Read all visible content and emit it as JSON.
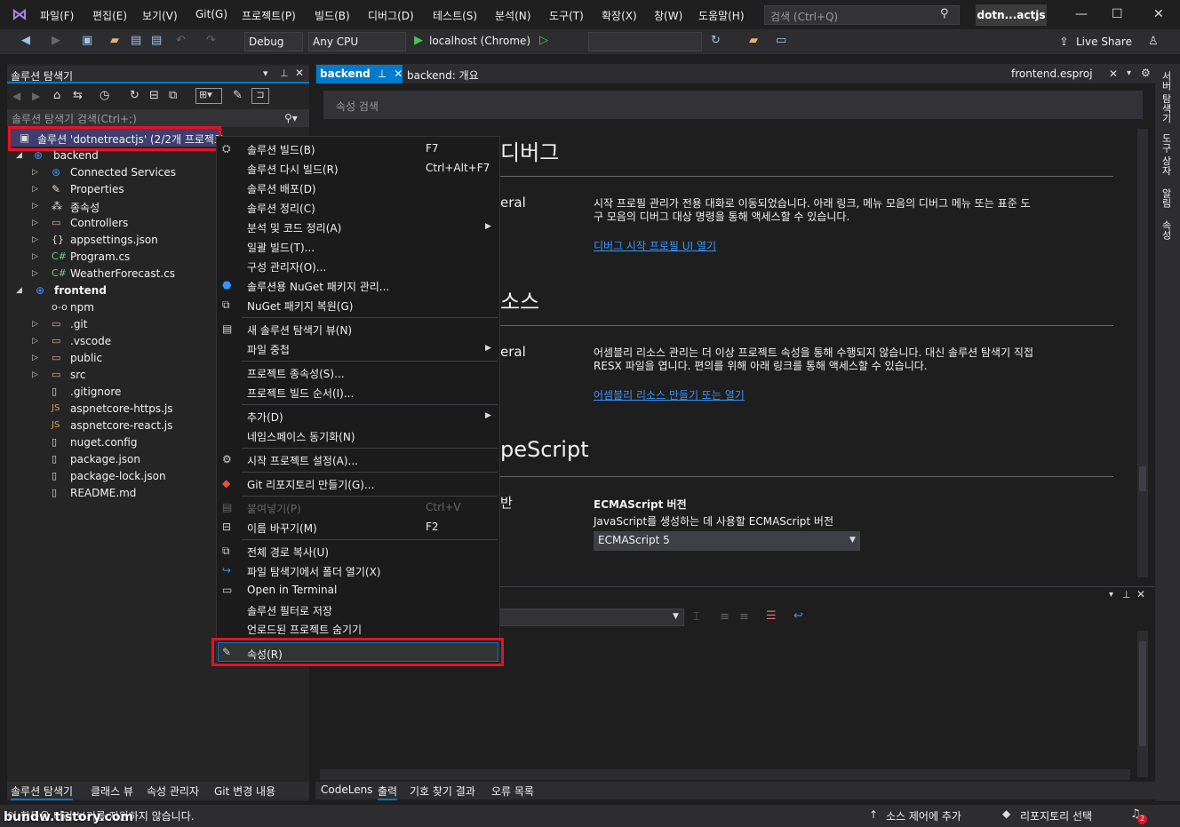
{
  "menubar": {
    "items": [
      "파일(F)",
      "편집(E)",
      "보기(V)",
      "Git(G)",
      "프로젝트(P)",
      "빌드(B)",
      "디버그(D)",
      "테스트(S)",
      "분석(N)",
      "도구(T)",
      "확장(X)",
      "창(W)",
      "도움말(H)"
    ],
    "search_placeholder": "검색 (Ctrl+Q)",
    "solution_name": "dotn...actjs"
  },
  "toolbar": {
    "config": "Debug",
    "platform": "Any CPU",
    "run_target": "localhost (Chrome)",
    "live_share": "Live Share"
  },
  "solution_explorer": {
    "title": "솔루션 탐색기",
    "search_placeholder": "솔루션 탐색기 검색(Ctrl+;)",
    "solution_label": "솔루션 'dotnetreactjs' (2/2개 프로젝트",
    "items": [
      {
        "label": "backend",
        "bold": false
      },
      {
        "label": "Connected Services"
      },
      {
        "label": "Properties"
      },
      {
        "label": "종속성"
      },
      {
        "label": "Controllers"
      },
      {
        "label": "appsettings.json"
      },
      {
        "label": "Program.cs"
      },
      {
        "label": "WeatherForecast.cs"
      },
      {
        "label": "frontend"
      },
      {
        "label": "npm"
      },
      {
        "label": ".git"
      },
      {
        "label": ".vscode"
      },
      {
        "label": "public"
      },
      {
        "label": "src"
      },
      {
        "label": ".gitignore"
      },
      {
        "label": "aspnetcore-https.js"
      },
      {
        "label": "aspnetcore-react.js"
      },
      {
        "label": "nuget.config"
      },
      {
        "label": "package.json"
      },
      {
        "label": "package-lock.json"
      },
      {
        "label": "README.md"
      }
    ],
    "bottom_tabs": [
      "솔루션 탐색기",
      "클래스 뷰",
      "속성 관리자",
      "Git 변경 내용"
    ]
  },
  "doc_tabs": {
    "tab1": "backend",
    "tab2": "backend: 개요",
    "tab3": "frontend.esproj"
  },
  "properties": {
    "search_placeholder": "속성 검색",
    "section1_title": "디버그",
    "section1_sub": "eral",
    "section1_desc": "시작 프로필 관리가 전용 대화로 이동되었습니다. 아래 링크, 메뉴 모음의 디버그 메뉴 또는 표준 도구 모음의 디버그 대상 명령을 통해 액세스할 수 있습니다.",
    "section1_link": "디버그 시작 프로필 UI 열기",
    "section2_title": "소스",
    "section2_sub": "eral",
    "section2_desc": "어셈블리 리소스 관리는 더 이상 프로젝트 속성을 통해 수행되지 않습니다. 대신 솔루션 탐색기 직접 RESX 파일을 엽니다. 편의를 위해 아래 링크를 통해 액세스할 수 있습니다.",
    "section2_link": "어셈블리 리소스 만들기 또는 열기",
    "section3_title": "peScript",
    "section3_sub": "반",
    "ecma_label": "ECMAScript 버전",
    "ecma_desc": "JavaScript를 생성하는 데 사용할 ECMAScript 버전",
    "ecma_value": "ECMAScript 5"
  },
  "output_tabs": [
    "CodeLens",
    "출력",
    "기호 찾기 결과",
    "오류 목록"
  ],
  "right_strip": [
    "서버 탐색기",
    "도구 상자",
    "알림",
    "속성"
  ],
  "context_menu": [
    {
      "label": "솔루션 빌드(B)",
      "key": "F7"
    },
    {
      "label": "솔루션 다시 빌드(R)",
      "key": "Ctrl+Alt+F7"
    },
    {
      "label": "솔루션 배포(D)",
      "key": ""
    },
    {
      "label": "솔루션 정리(C)",
      "key": ""
    },
    {
      "label": "분석 및 코드 정리(A)",
      "key": ""
    },
    {
      "label": "일괄 빌드(T)...",
      "key": ""
    },
    {
      "label": "구성 관리자(O)...",
      "key": ""
    },
    {
      "label": "솔루션용 NuGet 패키지 관리...",
      "key": ""
    },
    {
      "label": "NuGet 패키지 복원(G)",
      "key": ""
    },
    {
      "label": "새 솔루션 탐색기 뷰(N)",
      "key": ""
    },
    {
      "label": "파일 중첩",
      "key": ""
    },
    {
      "label": "프로젝트 종속성(S)...",
      "key": ""
    },
    {
      "label": "프로젝트 빌드 순서(I)...",
      "key": ""
    },
    {
      "label": "추가(D)",
      "key": ""
    },
    {
      "label": "네임스페이스 동기화(N)",
      "key": ""
    },
    {
      "label": "시작 프로젝트 설정(A)...",
      "key": ""
    },
    {
      "label": "Git 리포지토리 만들기(G)...",
      "key": ""
    },
    {
      "label": "붙여넣기(P)",
      "key": "Ctrl+V"
    },
    {
      "label": "이름 바꾸기(M)",
      "key": "F2"
    },
    {
      "label": "전체 경로 복사(U)",
      "key": ""
    },
    {
      "label": "파일 탐색기에서 폴더 열기(X)",
      "key": ""
    },
    {
      "label": "Open in Terminal",
      "key": ""
    },
    {
      "label": "솔루션 필터로 저장",
      "key": ""
    },
    {
      "label": "언로드된 프로젝트 숨기기",
      "key": ""
    },
    {
      "label": "속성(R)",
      "key": ""
    }
  ],
  "statusbar": {
    "left_text": "이 항목은 미리 보기를 지원하지 않습니다.",
    "source_control": "소스 제어에 추가",
    "repo": "리포지토리 선택",
    "notif_count": "2",
    "watermark": "bundw.tistory.com"
  }
}
